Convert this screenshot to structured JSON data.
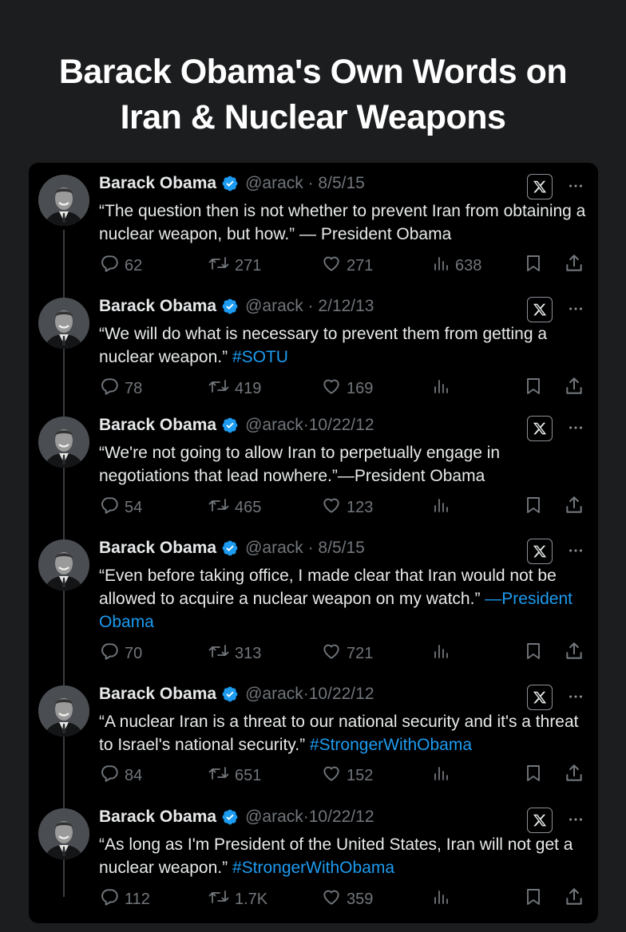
{
  "headline": {
    "line1": "Barack Obama's Own Words on",
    "line2": "Iran & Nuclear Weapons"
  },
  "icons": {
    "verified": "verified-badge-icon",
    "x_logo": "x-logo-icon",
    "more": "more-icon",
    "reply": "reply-icon",
    "retweet": "retweet-icon",
    "like": "like-icon",
    "views": "views-icon",
    "bookmark": "bookmark-icon",
    "share": "share-icon"
  },
  "colors": {
    "link": "#1d9bf0",
    "verified": "#1d9bf0",
    "muted": "#71767b"
  },
  "tweets": [
    {
      "name": "Barack Obama",
      "handle": "@arack · 8/5/15",
      "text": "“The question then is not whether to prevent Iran from obtaining a nuclear weapon, but how.” — President Obama",
      "link": "",
      "replies": "62",
      "retweets": "271",
      "likes": "271",
      "views": "638"
    },
    {
      "name": "Barack Obama",
      "handle": "@arack · 2/12/13",
      "text": "“We will do what is necessary to prevent them from getting a nuclear weapon.”",
      "link": "#SOTU",
      "replies": "78",
      "retweets": "419",
      "likes": "169",
      "views": ""
    },
    {
      "name": "Barack Obama",
      "handle": "@arack·10/22/12",
      "text": "“We're not going to allow Iran to perpetually engage in negotiations that lead nowhere.”—President Obama",
      "link": "",
      "replies": "54",
      "retweets": "465",
      "likes": "123",
      "views": ""
    },
    {
      "name": "Barack Obama",
      "handle": "@arack · 8/5/15",
      "text": "“Even before taking office, I made clear that Iran would not be allowed to acquire a nuclear weapon on my watch.”",
      "link": "—President Obama",
      "replies": "70",
      "retweets": "313",
      "likes": "721",
      "views": ""
    },
    {
      "name": "Barack Obama",
      "handle": "@arack·10/22/12",
      "text": "“A nuclear Iran is a threat to our national security and it's a threat to Israel's national security.”",
      "link": "#StrongerWithObama",
      "replies": "84",
      "retweets": "651",
      "likes": "152",
      "views": ""
    },
    {
      "name": "Barack Obama",
      "handle": "@arack·10/22/12",
      "text": "“As long as I'm President of the United States, Iran will not get a nuclear weapon.”",
      "link": "#StrongerWithObama",
      "replies": "112",
      "retweets": "1.7K",
      "likes": "359",
      "views": ""
    }
  ]
}
